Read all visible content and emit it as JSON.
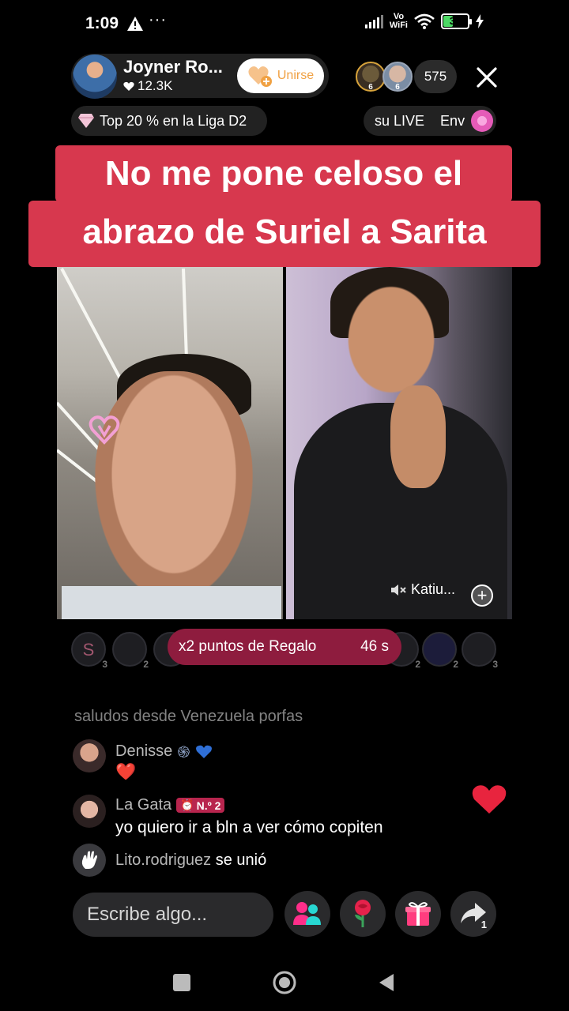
{
  "status": {
    "time": "1:09",
    "dots": "···",
    "vowifi_top": "Vo",
    "vowifi_bottom": "WiFi",
    "battery": "38"
  },
  "host": {
    "name": "Joyner Ro...",
    "likes": "12.3K",
    "join_label": "Unirse"
  },
  "viewers": {
    "badge1": "6",
    "badge2": "6",
    "count": "575"
  },
  "league": {
    "label": "Top 20 % en la Liga D2"
  },
  "live_pill": {
    "label1": "su LIVE",
    "label2": "Env"
  },
  "caption": {
    "line1": "No me pone celoso el",
    "line2": "abrazo de Suriel a Sarita"
  },
  "guest": {
    "name": "Katiu..."
  },
  "gifters": {
    "first_letter": "S",
    "ranks": [
      "3",
      "2",
      "2",
      "2",
      "3"
    ]
  },
  "regalo": {
    "label": "x2 puntos de Regalo",
    "timer": "46 s"
  },
  "chat": {
    "faded_text": "saludos desde Venezuela porfas",
    "messages": [
      {
        "user": "Denisse",
        "text": "❤️"
      },
      {
        "user": "La Gata",
        "badge": "N.º 2",
        "text": "yo quiero ir a bln a ver cómo copiten"
      }
    ],
    "join": {
      "user": "Lito.rodriguez",
      "text": "se unió"
    }
  },
  "composer": {
    "placeholder": "Escribe algo...",
    "share_count": "1"
  },
  "colors": {
    "caption_bg": "#d7384e",
    "regalo_bg": "#8e1c3e",
    "join_text": "#f0a143",
    "badge": "#b8254e"
  }
}
